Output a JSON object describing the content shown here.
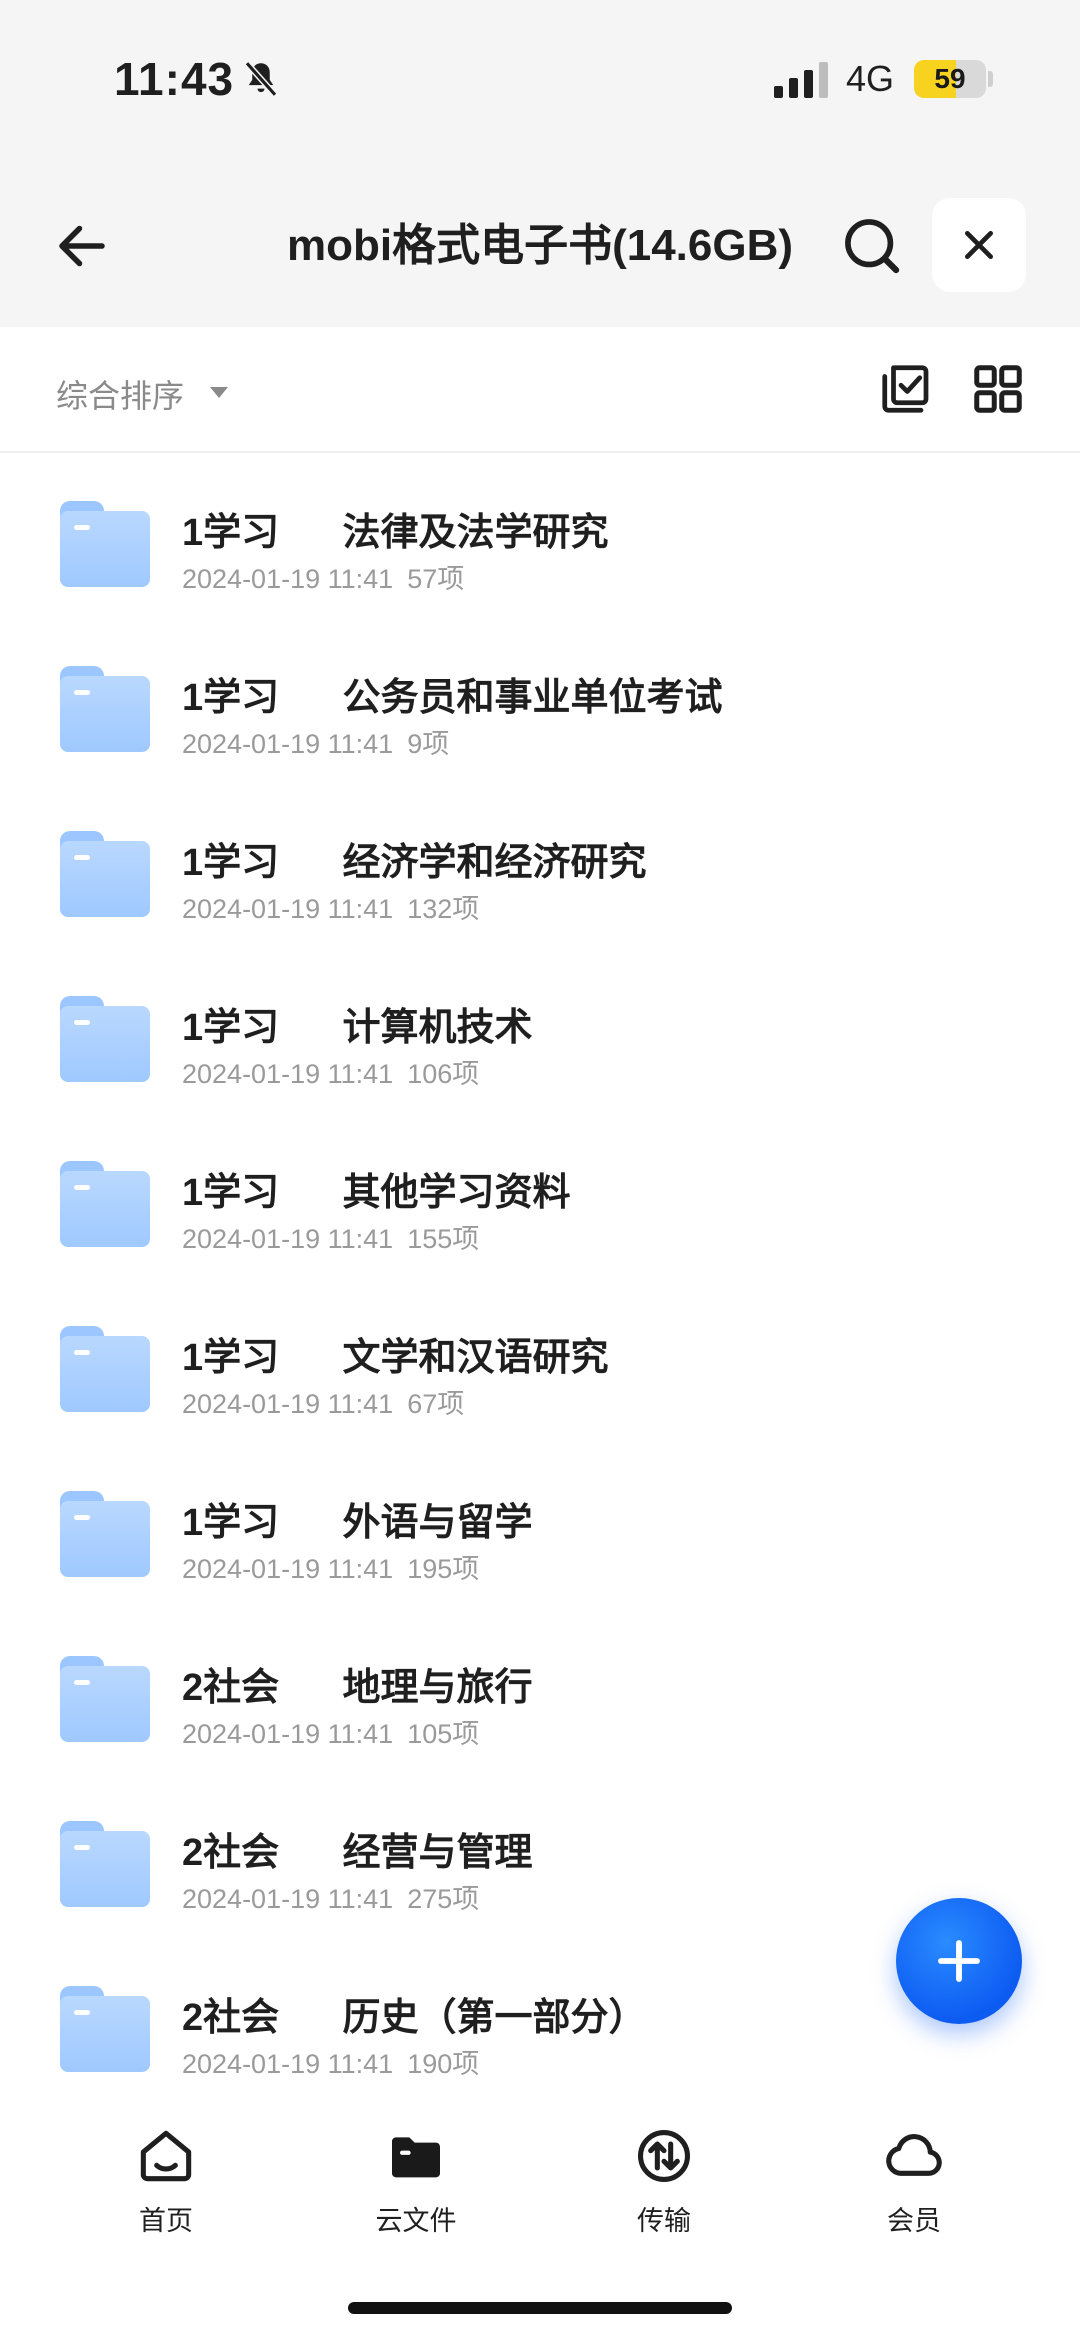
{
  "status_bar": {
    "time": "11:43",
    "network": "4G",
    "battery": "59",
    "battery_level": 0.59,
    "icons": [
      "bell-slash-icon",
      "signal-icon"
    ]
  },
  "header": {
    "title": "mobi格式电子书(14.6GB)",
    "icons": [
      "back-arrow-icon",
      "search-icon",
      "close-icon"
    ]
  },
  "toolbar": {
    "sort_label": "综合排序",
    "icons": [
      "caret-down-icon",
      "multi-select-icon",
      "grid-view-icon"
    ]
  },
  "folders": [
    {
      "title": "1学习      法律及法学研究",
      "date": "2024-01-19 11:41",
      "count": "57项"
    },
    {
      "title": "1学习      公务员和事业单位考试",
      "date": "2024-01-19 11:41",
      "count": "9项"
    },
    {
      "title": "1学习      经济学和经济研究",
      "date": "2024-01-19 11:41",
      "count": "132项"
    },
    {
      "title": "1学习      计算机技术",
      "date": "2024-01-19 11:41",
      "count": "106项"
    },
    {
      "title": "1学习      其他学习资料",
      "date": "2024-01-19 11:41",
      "count": "155项"
    },
    {
      "title": "1学习      文学和汉语研究",
      "date": "2024-01-19 11:41",
      "count": "67项"
    },
    {
      "title": "1学习      外语与留学",
      "date": "2024-01-19 11:41",
      "count": "195项"
    },
    {
      "title": "2社会      地理与旅行",
      "date": "2024-01-19 11:41",
      "count": "105项"
    },
    {
      "title": "2社会      经营与管理",
      "date": "2024-01-19 11:41",
      "count": "275项"
    },
    {
      "title": "2社会      历史（第一部分）",
      "date": "2024-01-19 11:41",
      "count": "190项"
    }
  ],
  "fab": {
    "icon": "plus-icon"
  },
  "tabs": [
    {
      "label": "首页",
      "icon": "home-icon"
    },
    {
      "label": "云文件",
      "icon": "folder-icon"
    },
    {
      "label": "传输",
      "icon": "transfer-icon"
    },
    {
      "label": "会员",
      "icon": "cloud-icon"
    }
  ],
  "colors": {
    "accent": "#0d5cf2",
    "folder": "#a9cfff",
    "battery": "#f7d21e",
    "meta_text": "#9a9a9a"
  }
}
